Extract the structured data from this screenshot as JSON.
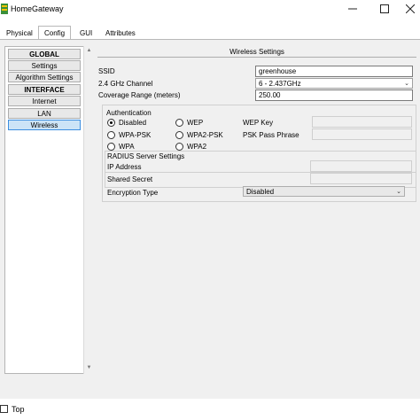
{
  "window": {
    "title": "HomeGateway",
    "min_icon": "minimize-icon",
    "max_icon": "maximize-icon",
    "close_icon": "close-icon"
  },
  "tabs": [
    {
      "label": "Physical"
    },
    {
      "label": "Config"
    },
    {
      "label": "GUI"
    },
    {
      "label": "Attributes"
    }
  ],
  "sidebar": {
    "items": [
      {
        "label": "GLOBAL"
      },
      {
        "label": "Settings"
      },
      {
        "label": "Algorithm Settings"
      },
      {
        "label": "INTERFACE"
      },
      {
        "label": "Internet"
      },
      {
        "label": "LAN"
      },
      {
        "label": "Wireless"
      }
    ]
  },
  "wireless": {
    "section_title": "Wireless Settings",
    "ssid_label": "SSID",
    "ssid_value": "greenhouse",
    "channel_label": "2.4 GHz Channel",
    "channel_value": "6 - 2.437GHz",
    "range_label": "Coverage Range (meters)",
    "range_value": "250.00",
    "auth": {
      "title": "Authentication",
      "options": [
        "Disabled",
        "WEP",
        "WPA-PSK",
        "WPA2-PSK",
        "WPA",
        "WPA2"
      ],
      "selected": "Disabled",
      "wep_key_label": "WEP Key",
      "psk_label": "PSK Pass Phrase"
    },
    "radius": {
      "title": "RADIUS Server Settings",
      "ip_label": "IP Address",
      "secret_label": "Shared Secret"
    },
    "encryption_label": "Encryption Type",
    "encryption_value": "Disabled"
  },
  "footer": {
    "top_label": "Top"
  }
}
